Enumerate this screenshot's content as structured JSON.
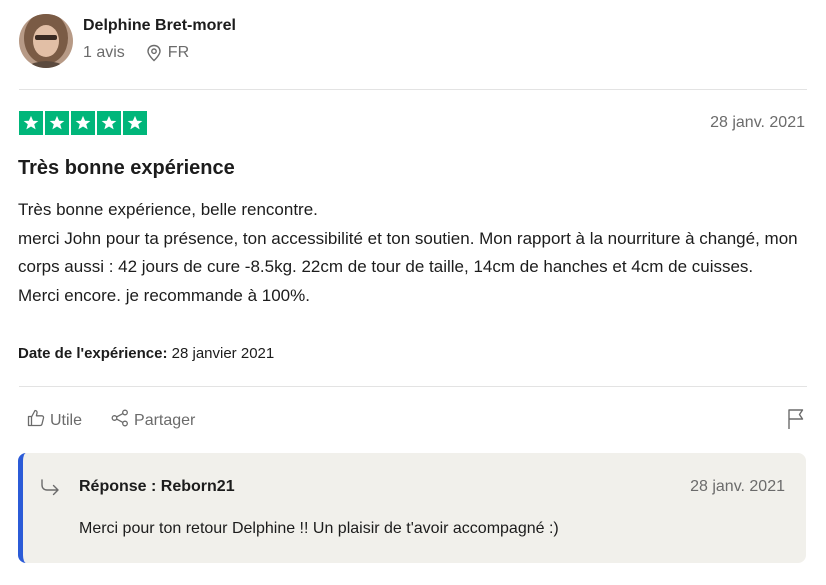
{
  "reviewer": {
    "name": "Delphine Bret-morel",
    "reviews_count": "1 avis",
    "country": "FR"
  },
  "review": {
    "rating": 5,
    "date": "28 janv. 2021",
    "title": "Très bonne expérience",
    "body_lines": [
      "Très bonne expérience, belle rencontre.",
      "merci John pour ta présence, ton accessibilité et ton soutien. Mon rapport à la nourriture à changé, mon corps aussi : 42 jours de cure -8.5kg. 22cm de tour de taille, 14cm de hanches et 4cm de cuisses.",
      "Merci encore. je recommande à 100%."
    ],
    "experience_label": "Date de l'expérience:",
    "experience_date": "28 janvier 2021"
  },
  "actions": {
    "useful": "Utile",
    "share": "Partager"
  },
  "reply": {
    "header": "Réponse : Reborn21",
    "date": "28 janv. 2021",
    "text": "Merci pour ton retour Delphine !! Un plaisir de t'avoir accompagné :)"
  },
  "colors": {
    "star_green": "#00b67a",
    "reply_accent": "#2b5bd7",
    "reply_bg": "#f1f0eb",
    "muted_text": "#6b6b6b"
  }
}
